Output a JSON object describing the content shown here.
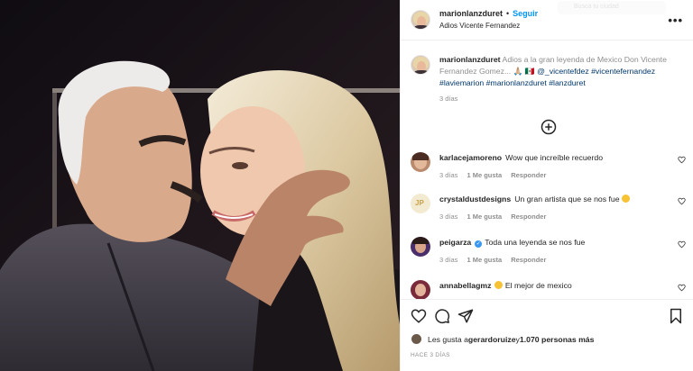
{
  "post": {
    "username": "marionlanzduret",
    "follow_label": "Seguir",
    "separator": "•",
    "location": "Adios Vicente Fernandez",
    "search_placeholder": "Busca tu ciudad"
  },
  "caption": {
    "username": "marionlanzduret",
    "text": " Adios a la gran leyenda de Mexico Don Vicente Fernandez Gomez... 🙏🏼 🇲🇽 ",
    "tags": "@_vicentefdez #vicentefernandez #laviemarion #marionlanzduret #lanzduret",
    "time": "3 días"
  },
  "comments": [
    {
      "username": "karlacejamoreno",
      "text": "Wow que increíble recuerdo",
      "time": "3 días",
      "likes": "1 Me gusta",
      "reply": "Responder",
      "avatar_color": "#b98a6e"
    },
    {
      "username": "crystaldustdesigns",
      "text": "Un gran artista que se nos fue",
      "emoji": true,
      "time": "3 días",
      "likes": "1 Me gusta",
      "reply": "Responder",
      "avatar_color": "#f1e6c8"
    },
    {
      "username": "peigarza",
      "verified": true,
      "text": "Toda una leyenda se nos fue",
      "time": "3 días",
      "likes": "1 Me gusta",
      "reply": "Responder",
      "avatar_color": "#4a2d6b"
    },
    {
      "username": "annabellagmz",
      "text": "El mejor de mexico",
      "emoji": true,
      "time": "",
      "likes": "",
      "reply": "",
      "avatar_color": "#7a2a3a"
    }
  ],
  "actions": {
    "likes_prefix": "Les gusta a ",
    "likes_user": "gerardoruize",
    "likes_mid": " y ",
    "likes_count": "1.070 personas más",
    "date": "HACE 3 DÍAS"
  },
  "icons": {
    "more": "more-icon",
    "add": "plus-circle-icon",
    "like": "heart-icon",
    "comment": "comment-icon",
    "share": "paper-plane-icon",
    "save": "bookmark-icon"
  },
  "colors": {
    "link": "#00376b",
    "follow": "#0095f6",
    "muted": "#8e8e8e"
  }
}
